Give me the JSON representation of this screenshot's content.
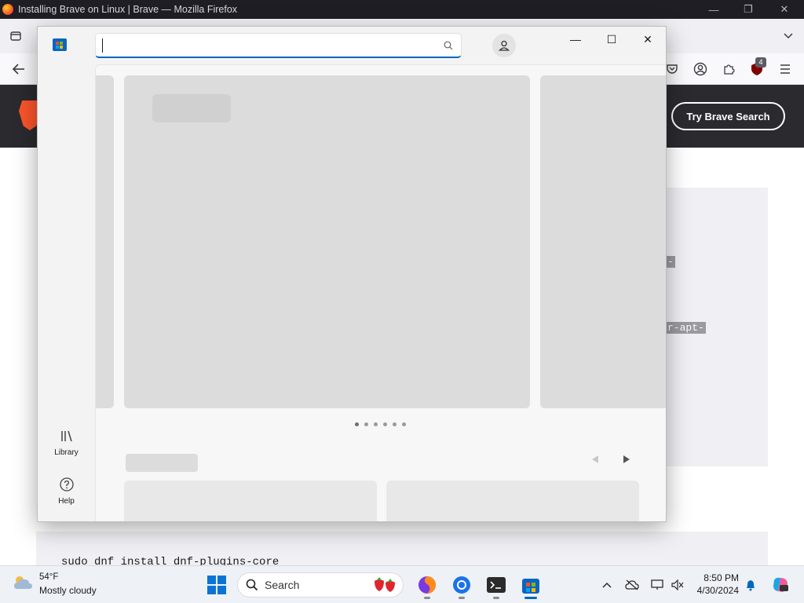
{
  "firefox": {
    "window_title": "Installing Brave on Linux | Brave — Mozilla Firefox",
    "minimize_glyph": "—",
    "restore_glyph": "❐",
    "close_glyph": "✕",
    "extension_badge": "4"
  },
  "page": {
    "try_brave_button": "Try Brave Search",
    "code_fragment_1": "-",
    "code_fragment_2": "r-apt-",
    "code_line": "sudo dnf install dnf-plugins-core"
  },
  "store": {
    "search": {
      "value": "",
      "placeholder": ""
    },
    "nav": [
      {
        "label": "Library",
        "icon": "library-icon"
      },
      {
        "label": "Help",
        "icon": "help-icon"
      }
    ],
    "carousel": {
      "dot_count": 6,
      "active_index": 0
    },
    "window_controls": {
      "minimize": "—",
      "maximize": "☐",
      "close": "✕"
    }
  },
  "taskbar": {
    "weather": {
      "temp": "54°F",
      "desc": "Mostly cloudy"
    },
    "search_label": "Search",
    "clock": {
      "time": "8:50 PM",
      "date": "4/30/2024"
    }
  },
  "colors": {
    "firefox_titlebar": "#1f1e25",
    "brave_header": "#2b2b2f",
    "store_accent": "#0067c0",
    "skeleton": "#dcdcdc"
  }
}
